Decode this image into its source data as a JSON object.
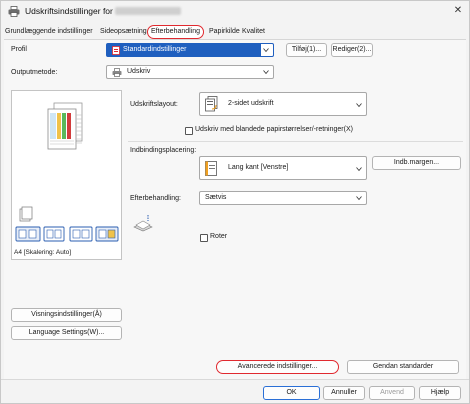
{
  "window": {
    "title": "Udskriftsindstillinger for",
    "close_glyph": "✕"
  },
  "tabs": [
    {
      "label": "Grundlæggende indstillinger"
    },
    {
      "label": "Sideopsætning"
    },
    {
      "label": "Efterbehandling",
      "active": true
    },
    {
      "label": "Papirkilde"
    },
    {
      "label": "Kvalitet"
    }
  ],
  "profile": {
    "label": "Profil",
    "value": "Standardindstillinger",
    "add_button": "Tilføj(1)...",
    "edit_button": "Rediger(2)..."
  },
  "output_method": {
    "label": "Outputmetode:",
    "value": "Udskriv"
  },
  "preview": {
    "caption": "A4 [Skalering: Auto]"
  },
  "print_layout": {
    "label": "Udskriftslayout:",
    "value": "2-sidet udskrift",
    "mixed_label": "Udskriv med blandede papirstørrelser/-retninger(X)",
    "mixed_checked": false
  },
  "binding": {
    "label": "Indbindingsplacering:",
    "value": "Lang kant [Venstre]",
    "margin_button": "Indb.margen..."
  },
  "finishing": {
    "label": "Efterbehandling:",
    "value": "Sætvis",
    "rotate_label": "Roter",
    "rotate_checked": false
  },
  "left_buttons": {
    "view_settings": "Visningsindstillinger(Å)",
    "language_settings": "Language Settings(W)..."
  },
  "advanced": {
    "advanced_button": "Avancerede indstillinger...",
    "restore_button": "Gendan standarder"
  },
  "footer": {
    "ok": "OK",
    "cancel": "Annuller",
    "apply": "Anvend",
    "help": "Hjælp"
  },
  "colors": {
    "accent_blue": "#1f5fbf",
    "highlight_red": "#e0292f",
    "ok_border": "#2a6fd6"
  }
}
